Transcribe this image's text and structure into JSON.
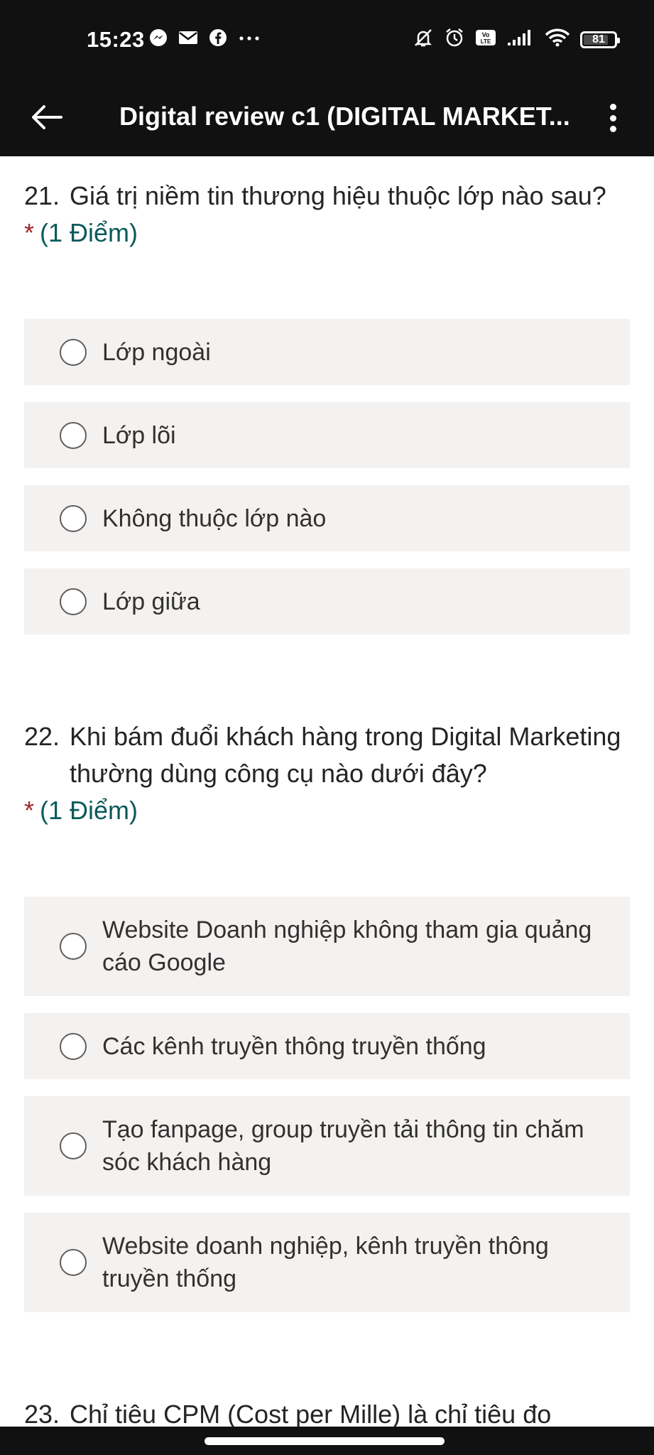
{
  "status_bar": {
    "time": "15:23",
    "left_icons": [
      "messenger-icon",
      "mail-icon",
      "facebook-icon",
      "more-dots-icon"
    ],
    "right_icons": [
      "bell-off-icon",
      "alarm-icon",
      "volte-icon",
      "signal-icon",
      "wifi-icon"
    ],
    "battery": "81",
    "battery_level": 0.81
  },
  "app_bar": {
    "title": "Digital review c1 (DIGITAL MARKET..."
  },
  "questions": [
    {
      "number": "21.",
      "text": "Giá trị niềm tin thương hiệu thuộc lớp nào sau?",
      "required_mark": "*",
      "points": "(1 Điểm)",
      "options": [
        "Lớp ngoài",
        "Lớp lõi",
        "Không thuộc lớp nào",
        "Lớp giữa"
      ]
    },
    {
      "number": "22.",
      "text": "Khi bám đuổi khách hàng trong Digital Marketing thường dùng công cụ nào dưới đây?",
      "required_mark": "*",
      "points": "(1 Điểm)",
      "options": [
        "Website Doanh nghiệp không tham gia quảng cáo Google",
        "Các kênh truyền thông truyền thống",
        "Tạo fanpage, group truyền tải thông tin chăm sóc khách hàng",
        "Website doanh nghiệp, kênh truyền thông truyền thống"
      ]
    },
    {
      "number": "23.",
      "text": "Chỉ tiêu CPM (Cost per Mille) là chỉ tiêu đo"
    }
  ]
}
